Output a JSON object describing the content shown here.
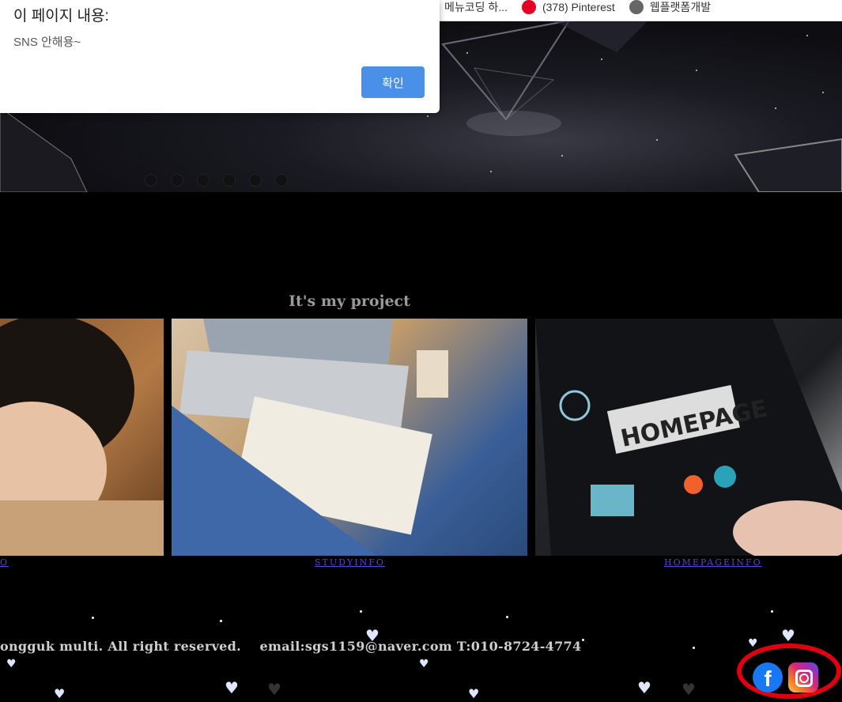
{
  "bookmarks": [
    {
      "label": "메뉴코딩 하...",
      "icon": ""
    },
    {
      "label": "(378) Pinterest",
      "icon": "pinterest-icon"
    },
    {
      "label": "웹플랫폼개발",
      "icon": "globe-icon"
    }
  ],
  "dialog": {
    "title": "이 페이지 내용:",
    "message": "SNS 안해용~",
    "ok_label": "확인"
  },
  "slider": {
    "dot_count": 6
  },
  "project": {
    "title": "It's my project",
    "cards": [
      {
        "link": "O"
      },
      {
        "link": "STUDYINFO"
      },
      {
        "link": "HOMEPAGEINFO"
      }
    ]
  },
  "footer": {
    "copyright": "ongguk multi. All right reserved.",
    "contact": "email:sgs1159@naver.com T:010-8724-4774"
  },
  "social": {
    "facebook_icon": "facebook-icon",
    "instagram_icon": "instagram-icon",
    "highlight_color": "#e00010"
  },
  "colors": {
    "dialog_button": "#4a90e8",
    "link": "#5b3fd6"
  }
}
